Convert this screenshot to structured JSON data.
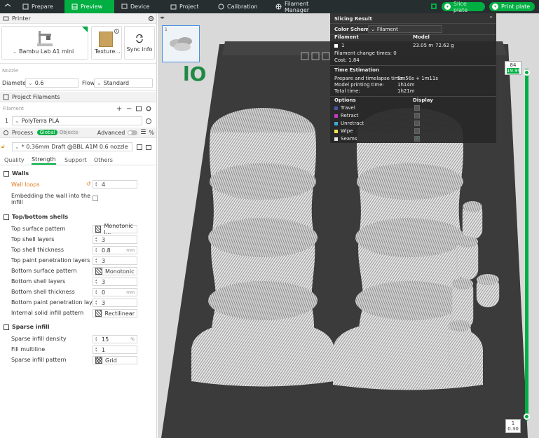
{
  "topbar": {
    "tabs": [
      {
        "label": "Prepare",
        "icon": "prepare-icon",
        "active": false
      },
      {
        "label": "Preview",
        "icon": "preview-icon",
        "active": true
      },
      {
        "label": "Device",
        "icon": "device-icon",
        "active": false
      },
      {
        "label": "Project",
        "icon": "project-icon",
        "active": false
      },
      {
        "label": "Calibration",
        "icon": "calibration-icon",
        "active": false
      },
      {
        "label": "Filament Manager",
        "icon": "filament-manager-icon",
        "active": false
      }
    ],
    "slice_label": "Slice plate",
    "print_label": "Print plate"
  },
  "printer": {
    "section_title": "Printer",
    "name": "Bambu Lab A1 mini",
    "texture_label": "Texture...",
    "sync_label": "Sync info",
    "nozzle_label": "Nozzle",
    "diameter_label": "Diameter",
    "diameter_value": "0.6",
    "flow_label": "Flow",
    "flow_value": "Standard"
  },
  "filaments": {
    "section_title": "Project Filaments",
    "header_label": "Filament",
    "items": [
      {
        "index": "1",
        "name": "PolyTerra PLA"
      }
    ]
  },
  "process": {
    "section_title": "Process",
    "toggle_global": "Global",
    "toggle_objects": "Objects",
    "advanced_label": "Advanced",
    "preset": "* 0.36mm Draft @BBL A1M 0.6 nozzle",
    "tabs": [
      "Quality",
      "Strength",
      "Support",
      "Others"
    ],
    "active_tab": "Strength"
  },
  "walls": {
    "title": "Walls",
    "wall_loops_label": "Wall loops",
    "wall_loops_value": "4",
    "embed_label_1": "Embedding the wall into the",
    "embed_label_2": "infill"
  },
  "topbottom": {
    "title": "Top/bottom shells",
    "rows": [
      {
        "label": "Top surface pattern",
        "value": "Monotonic l...",
        "kind": "pattern"
      },
      {
        "label": "Top shell layers",
        "value": "3",
        "kind": "stepper"
      },
      {
        "label": "Top shell thickness",
        "value": "0.8",
        "unit": "mm",
        "kind": "unit"
      },
      {
        "label": "Top paint penetration layers",
        "value": "3",
        "kind": "stepper"
      },
      {
        "label": "Bottom surface pattern",
        "value": "Monotonic",
        "kind": "pattern"
      },
      {
        "label": "Bottom shell layers",
        "value": "3",
        "kind": "stepper"
      },
      {
        "label": "Bottom shell thickness",
        "value": "0",
        "unit": "mm",
        "kind": "unit"
      },
      {
        "label": "Bottom paint penetration layers",
        "value": "3",
        "kind": "stepper"
      },
      {
        "label": "Internal solid infill pattern",
        "value": "Rectilinear",
        "kind": "pattern"
      }
    ]
  },
  "sparse": {
    "title": "Sparse infill",
    "rows": [
      {
        "label": "Sparse infill density",
        "value": "15",
        "unit": "%",
        "kind": "unit"
      },
      {
        "label": "Fill multiline",
        "value": "1",
        "kind": "stepper"
      },
      {
        "label": "Sparse infill pattern",
        "value": "Grid",
        "kind": "grid"
      }
    ]
  },
  "thumbnail": {
    "number": "1"
  },
  "slicing": {
    "title": "Slicing Result",
    "color_scheme_label": "Color Scheme",
    "color_scheme_value": "Filament",
    "col_filament": "Filament",
    "col_model": "Model",
    "filament_index": "1",
    "model_length": "23.05 m",
    "model_weight": "72.62 g",
    "change_times": "Filament change times:  0",
    "cost": "Cost:  1.84",
    "time_title": "Time Estimation",
    "prepare_label": "Prepare and timelapse time:",
    "prepare_value": "5m56s + 1m11s",
    "model_time_label": "Model printing time:",
    "model_time_value": "1h14m",
    "total_label": "Total time:",
    "total_value": "1h21m",
    "options_label": "Options",
    "display_label": "Display",
    "options": [
      {
        "name": "Travel",
        "color": "#4a56a6",
        "checked": false
      },
      {
        "name": "Retract",
        "color": "#c03cc0",
        "checked": false
      },
      {
        "name": "Unretract",
        "color": "#3fa9d8",
        "checked": false
      },
      {
        "name": "Wipe",
        "color": "#f0e050",
        "checked": false
      },
      {
        "name": "Seams",
        "color": "#e8e8e8",
        "checked": true
      }
    ]
  },
  "layer_slider": {
    "top_layer": "84",
    "top_height": "19.99",
    "bottom_layer": "1",
    "bottom_height": "0.30"
  },
  "colors": {
    "accent": "#00ae42",
    "topbar": "#262e30",
    "viewport": "#d9d9d9"
  }
}
